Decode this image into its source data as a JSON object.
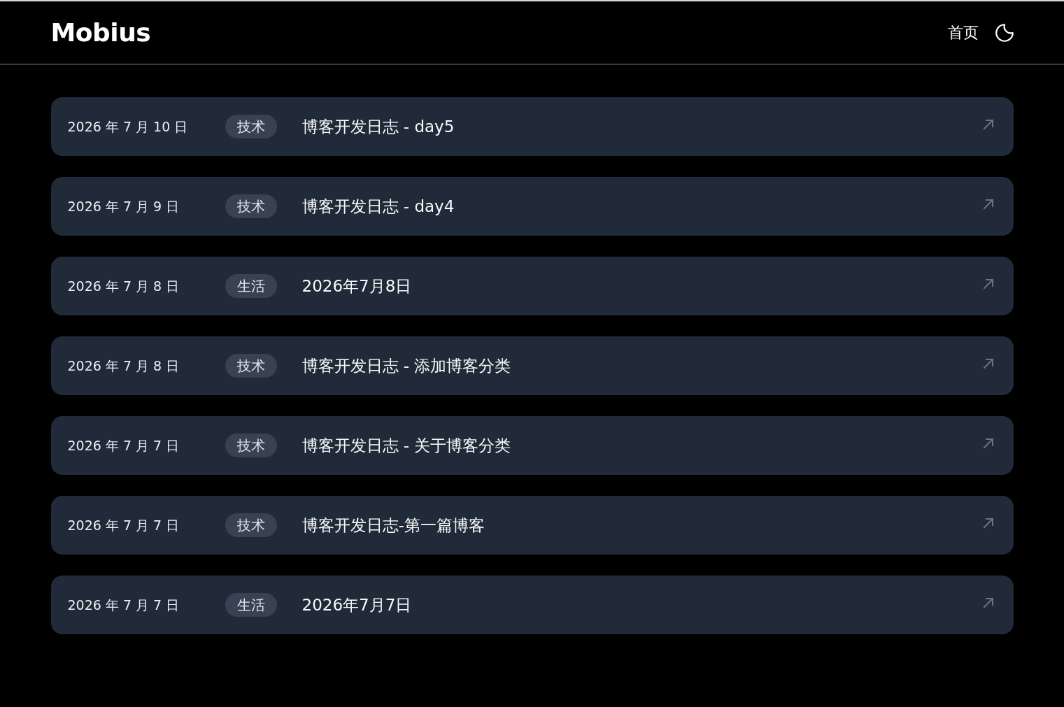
{
  "header": {
    "brand": "Mobius",
    "nav": [
      {
        "label": "首页"
      }
    ]
  },
  "posts": [
    {
      "date": "2026 年 7 月 10 日",
      "category": "技术",
      "title": "博客开发日志 - day5"
    },
    {
      "date": "2026 年 7 月 9 日",
      "category": "技术",
      "title": "博客开发日志 - day4"
    },
    {
      "date": "2026 年 7 月 8 日",
      "category": "生活",
      "title": "2026年7月8日"
    },
    {
      "date": "2026 年 7 月 8 日",
      "category": "技术",
      "title": "博客开发日志 - 添加博客分类"
    },
    {
      "date": "2026 年 7 月 7 日",
      "category": "技术",
      "title": "博客开发日志 - 关于博客分类"
    },
    {
      "date": "2026 年 7 月 7 日",
      "category": "技术",
      "title": "博客开发日志-第一篇博客"
    },
    {
      "date": "2026 年 7 月 7 日",
      "category": "生活",
      "title": "2026年7月7日"
    }
  ]
}
